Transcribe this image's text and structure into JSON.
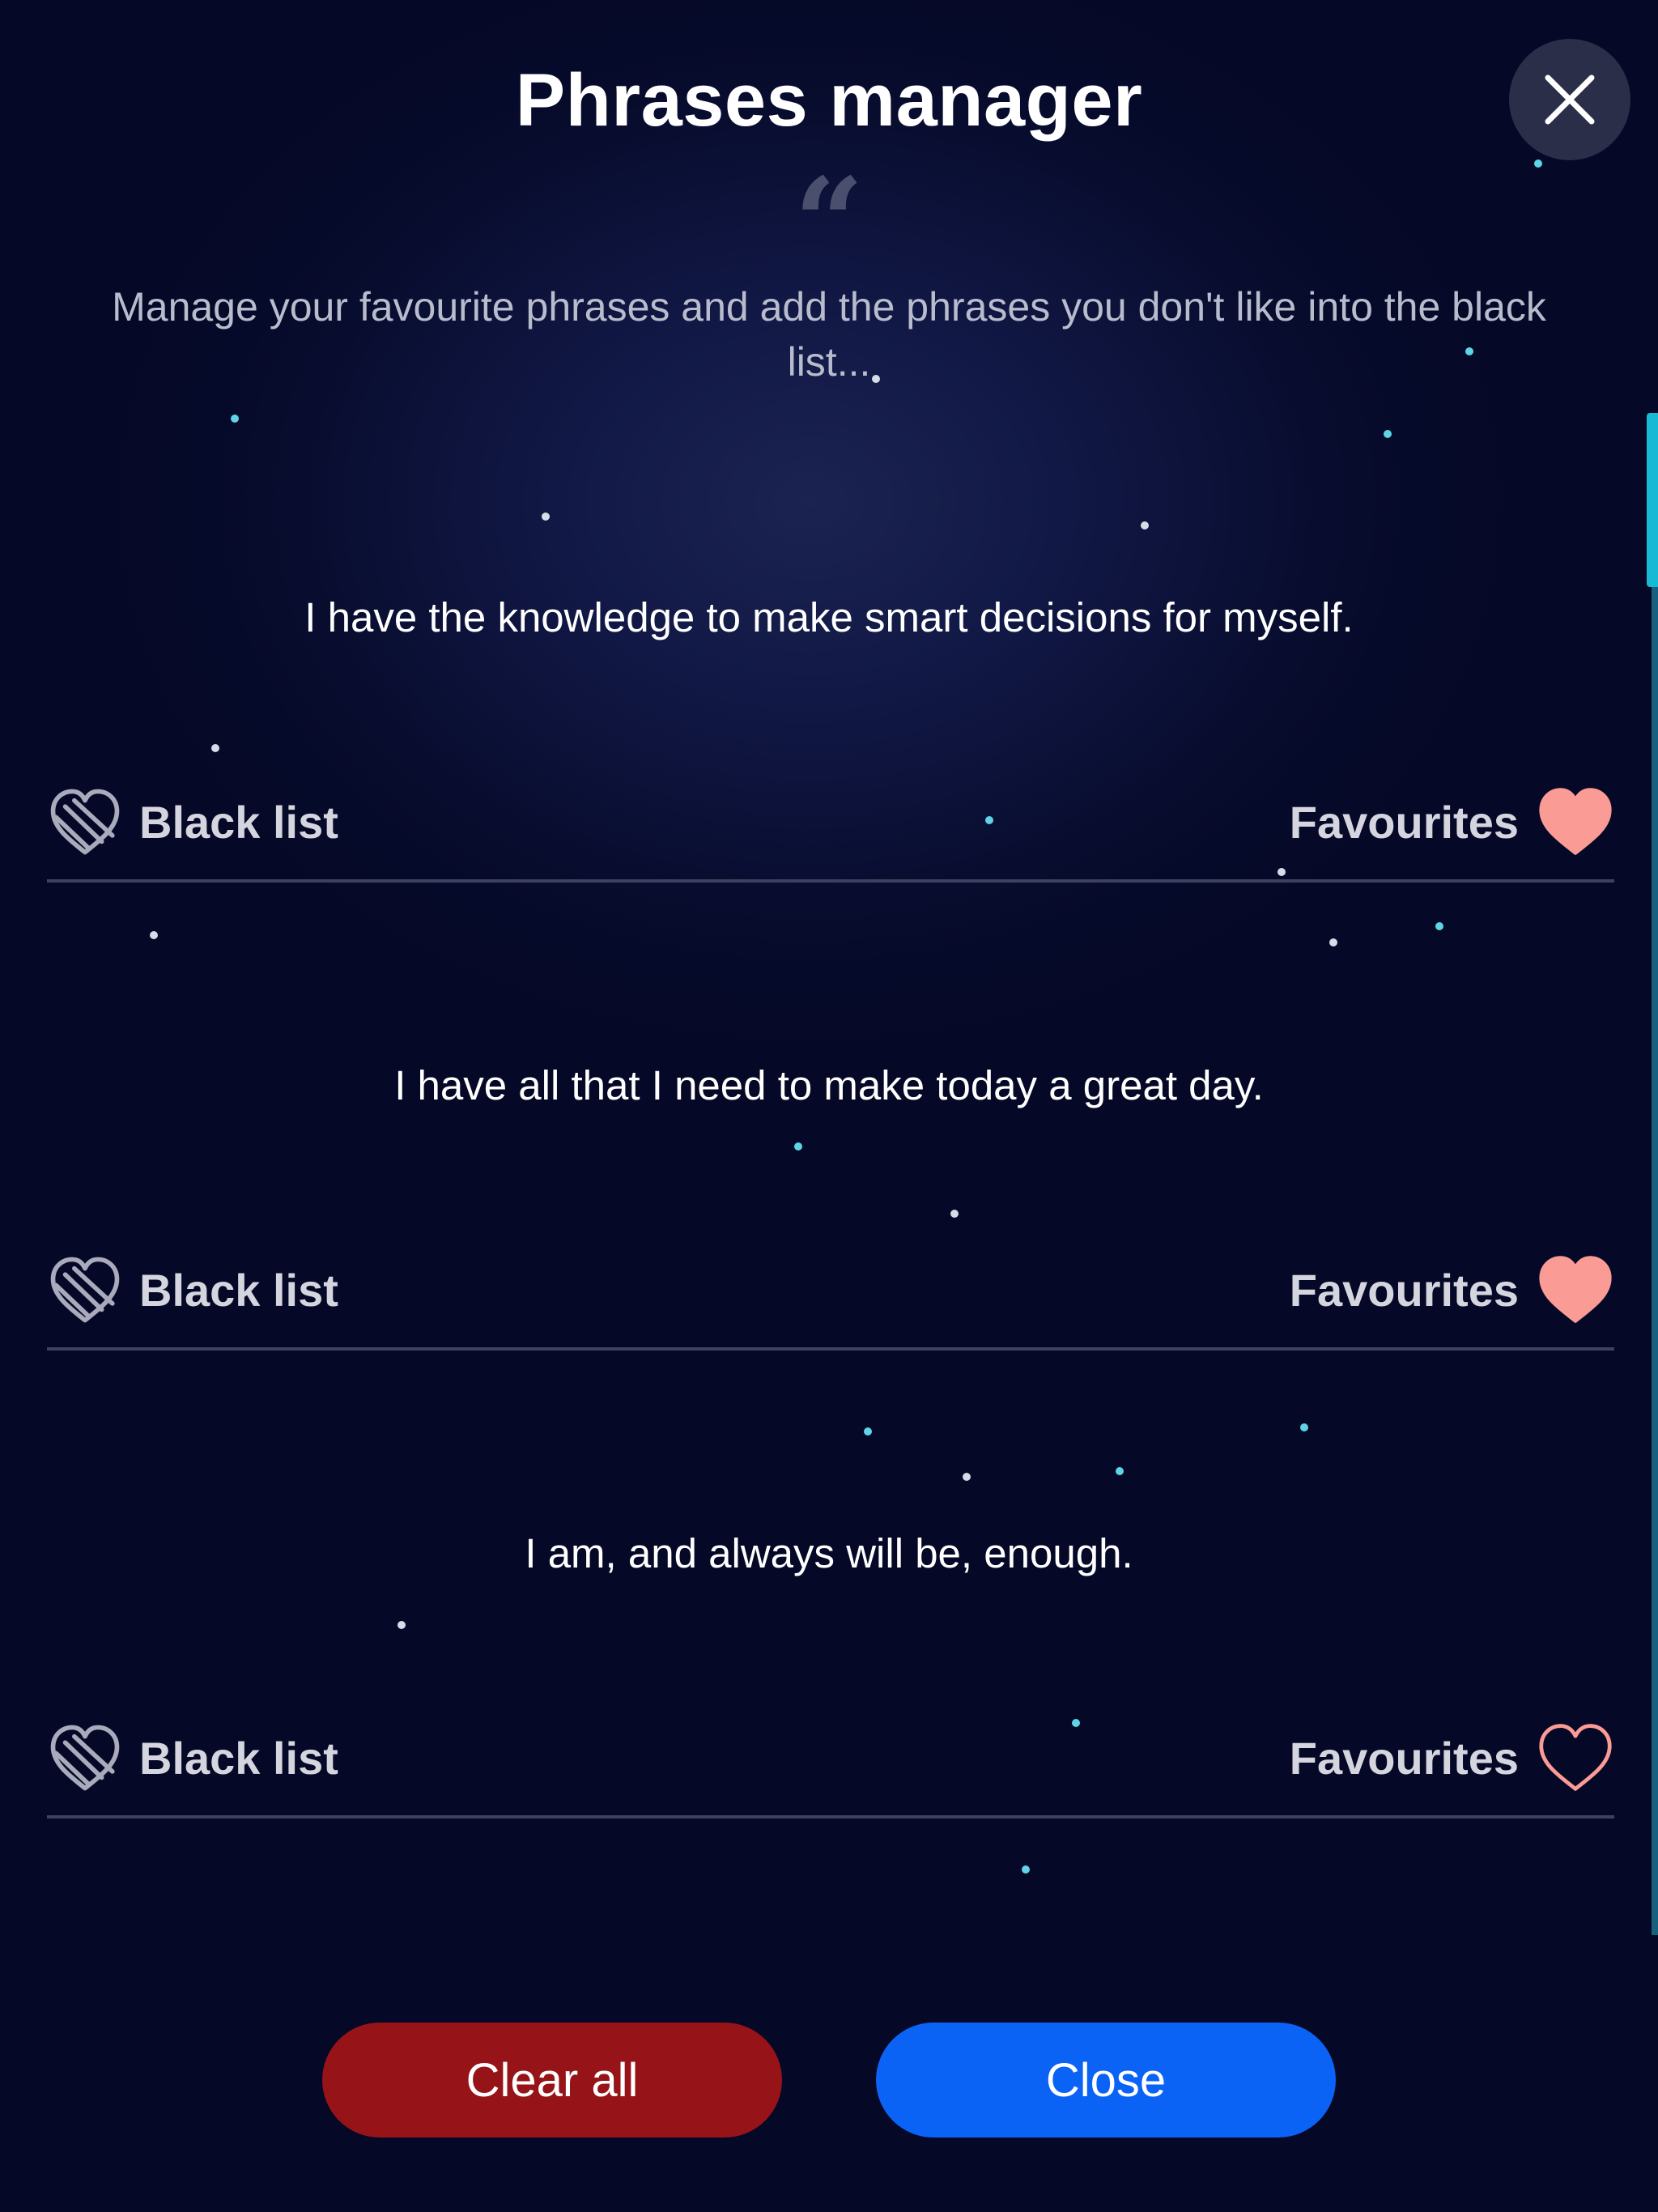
{
  "header": {
    "title": "Phrases manager",
    "quote_glyph": "“",
    "subtitle": "Manage your favourite phrases and add the phrases you don't like into the black list..."
  },
  "phrases": [
    {
      "text": "I have the knowledge to make smart decisions for myself.",
      "blacklist_label": "Black list",
      "favourites_label": "Favourites",
      "favourited": true
    },
    {
      "text": "I have all that I need to make today a great day.",
      "blacklist_label": "Black list",
      "favourites_label": "Favourites",
      "favourited": true
    },
    {
      "text": "I am, and always will be, enough.",
      "blacklist_label": "Black list",
      "favourites_label": "Favourites",
      "favourited": false
    }
  ],
  "footer": {
    "clear_all_label": "Clear all",
    "close_label": "Close"
  },
  "colors": {
    "heart_fill": "#fb9b95",
    "clear_button": "#961417",
    "close_button": "#0b63f5",
    "scroll_accent": "#18b9d4"
  },
  "icons": {
    "close": "close-icon",
    "blacklist": "broken-heart-icon",
    "favourite_filled": "heart-filled-icon",
    "favourite_outline": "heart-outline-icon"
  }
}
